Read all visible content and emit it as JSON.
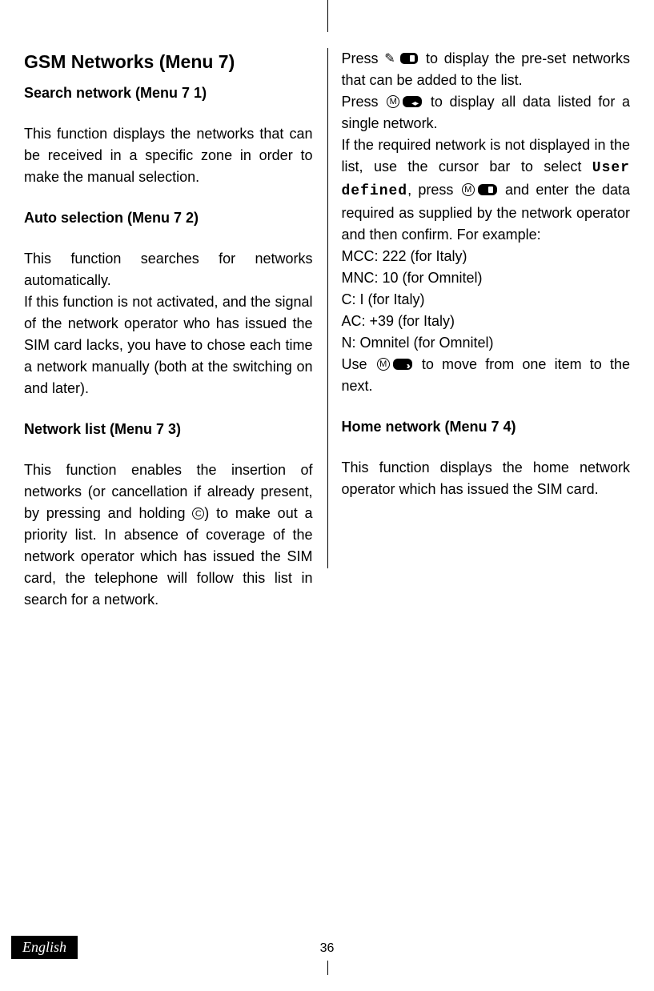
{
  "left": {
    "h1": "GSM Networks (Menu 7)",
    "h2a": "Search network (Menu 7 1)",
    "p1": "This function displays the networks that can be received in a specific zone in order to make the manual selection.",
    "h2b": "Auto selection (Menu 7 2)",
    "p2": "This function searches for networks automatically.",
    "p3": "If this function is not activated, and the signal of the network operator who has issued the SIM card lacks, you have to chose each time a network manually (both at the switching on and later).",
    "h2c": "Network list (Menu 7 3)",
    "p4a": "This function enables the insertion of networks (or cancellation if already present, by pressing and holding ",
    "p4b": ") to make out a priority list. In absence of coverage of the network operator which has issued the SIM card, the telephone will follow this list in search for a network."
  },
  "right": {
    "p1a": "Press ",
    "p1b": " to display the pre-set networks that can be added to the list.",
    "p2a": "Press ",
    "p2b": " to display all data listed for a single network.",
    "p3a": "If the required network is not displayed in the list, use the cursor bar to select ",
    "p3mono": "User defined",
    "p3b": ", press ",
    "p3c": " and enter the data required as supplied by the network operator and then confirm. For example:",
    "l1": "MCC: 222 (for Italy)",
    "l2": "MNC: 10 (for Omnitel)",
    "l3": "C: I (for Italy)",
    "l4": "AC: +39 (for Italy)",
    "l5": "N: Omnitel (for Omnitel)",
    "p4a": "Use ",
    "p4b": " to move from one item to the next.",
    "h2d": "Home network (Menu 7 4)",
    "p5": "This function displays the home network operator which has issued the SIM card."
  },
  "footer": {
    "lang": "English",
    "page": "36"
  },
  "icons": {
    "c_key": "C"
  }
}
